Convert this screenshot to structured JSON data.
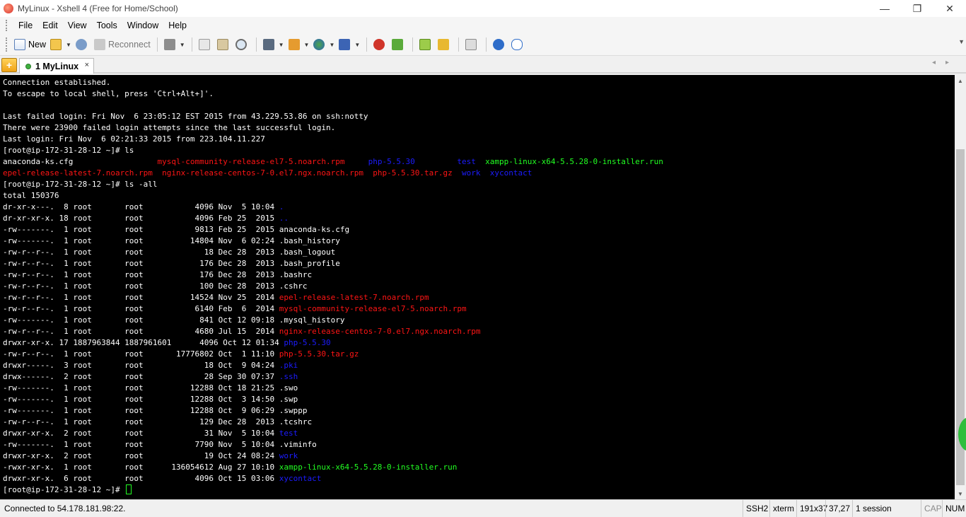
{
  "window": {
    "title": "MyLinux - Xshell 4 (Free for Home/School)",
    "controls": [
      "—",
      "❐",
      "✕"
    ]
  },
  "menu": [
    "File",
    "Edit",
    "View",
    "Tools",
    "Window",
    "Help"
  ],
  "toolbar": {
    "new_label": "New",
    "reconnect_label": "Reconnect"
  },
  "tabs": {
    "add_symbol": "+",
    "active_label": "1 MyLinux",
    "close_symbol": "×",
    "nav_symbols": "◂▸"
  },
  "terminal": {
    "lines": [
      [
        {
          "t": "Connection established."
        }
      ],
      [
        {
          "t": "To escape to local shell, press 'Ctrl+Alt+]'."
        }
      ],
      [
        {
          "t": ""
        }
      ],
      [
        {
          "t": "Last failed login: Fri Nov  6 23:05:12 EST 2015 from 43.229.53.86 on ssh:notty"
        }
      ],
      [
        {
          "t": "There were 23900 failed login attempts since the last successful login."
        }
      ],
      [
        {
          "t": "Last login: Fri Nov  6 02:21:33 2015 from 223.104.11.227"
        }
      ],
      [
        {
          "t": "[root@ip-172-31-28-12 ~]# ls"
        }
      ],
      [
        {
          "t": "anaconda-ks.cfg                  "
        },
        {
          "t": "mysql-community-release-el7-5.noarch.rpm",
          "c": "red"
        },
        {
          "t": "     "
        },
        {
          "t": "php-5.5.30",
          "c": "blue"
        },
        {
          "t": "         "
        },
        {
          "t": "test",
          "c": "blue"
        },
        {
          "t": "  "
        },
        {
          "t": "xampp-linux-x64-5.5.28-0-installer.run",
          "c": "green"
        }
      ],
      [
        {
          "t": "epel-release-latest-7.noarch.rpm",
          "c": "red"
        },
        {
          "t": "  "
        },
        {
          "t": "nginx-release-centos-7-0.el7.ngx.noarch.rpm",
          "c": "red"
        },
        {
          "t": "  "
        },
        {
          "t": "php-5.5.30.tar.gz",
          "c": "red"
        },
        {
          "t": "  "
        },
        {
          "t": "work",
          "c": "blue"
        },
        {
          "t": "  "
        },
        {
          "t": "xycontact",
          "c": "blue"
        }
      ],
      [
        {
          "t": "[root@ip-172-31-28-12 ~]# ls -all"
        }
      ],
      [
        {
          "t": "total 150376"
        }
      ],
      [
        {
          "t": "dr-xr-x---.  8 root       root           4096 Nov  5 10:04 "
        },
        {
          "t": ".",
          "c": "blue"
        }
      ],
      [
        {
          "t": "dr-xr-xr-x. 18 root       root           4096 Feb 25  2015 "
        },
        {
          "t": "..",
          "c": "blue"
        }
      ],
      [
        {
          "t": "-rw-------.  1 root       root           9813 Feb 25  2015 anaconda-ks.cfg"
        }
      ],
      [
        {
          "t": "-rw-------.  1 root       root          14804 Nov  6 02:24 .bash_history"
        }
      ],
      [
        {
          "t": "-rw-r--r--.  1 root       root             18 Dec 28  2013 .bash_logout"
        }
      ],
      [
        {
          "t": "-rw-r--r--.  1 root       root            176 Dec 28  2013 .bash_profile"
        }
      ],
      [
        {
          "t": "-rw-r--r--.  1 root       root            176 Dec 28  2013 .bashrc"
        }
      ],
      [
        {
          "t": "-rw-r--r--.  1 root       root            100 Dec 28  2013 .cshrc"
        }
      ],
      [
        {
          "t": "-rw-r--r--.  1 root       root          14524 Nov 25  2014 "
        },
        {
          "t": "epel-release-latest-7.noarch.rpm",
          "c": "red"
        }
      ],
      [
        {
          "t": "-rw-r--r--.  1 root       root           6140 Feb  6  2014 "
        },
        {
          "t": "mysql-community-release-el7-5.noarch.rpm",
          "c": "red"
        }
      ],
      [
        {
          "t": "-rw-------.  1 root       root            841 Oct 12 09:18 .mysql_history"
        }
      ],
      [
        {
          "t": "-rw-r--r--.  1 root       root           4680 Jul 15  2014 "
        },
        {
          "t": "nginx-release-centos-7-0.el7.ngx.noarch.rpm",
          "c": "red"
        }
      ],
      [
        {
          "t": "drwxr-xr-x. 17 1887963844 1887961601      4096 Oct 12 01:34 "
        },
        {
          "t": "php-5.5.30",
          "c": "blue"
        }
      ],
      [
        {
          "t": "-rw-r--r--.  1 root       root       17776802 Oct  1 11:10 "
        },
        {
          "t": "php-5.5.30.tar.gz",
          "c": "red"
        }
      ],
      [
        {
          "t": "drwxr-----.  3 root       root             18 Oct  9 04:24 "
        },
        {
          "t": ".pki",
          "c": "blue"
        }
      ],
      [
        {
          "t": "drwx------.  2 root       root             28 Sep 30 07:37 "
        },
        {
          "t": ".ssh",
          "c": "blue"
        }
      ],
      [
        {
          "t": "-rw-------.  1 root       root          12288 Oct 18 21:25 .swo"
        }
      ],
      [
        {
          "t": "-rw-------.  1 root       root          12288 Oct  3 14:50 .swp"
        }
      ],
      [
        {
          "t": "-rw-------.  1 root       root          12288 Oct  9 06:29 .swppp"
        }
      ],
      [
        {
          "t": "-rw-r--r--.  1 root       root            129 Dec 28  2013 .tcshrc"
        }
      ],
      [
        {
          "t": "drwxr-xr-x.  2 root       root             31 Nov  5 10:04 "
        },
        {
          "t": "test",
          "c": "blue"
        }
      ],
      [
        {
          "t": "-rw-------.  1 root       root           7790 Nov  5 10:04 .viminfo"
        }
      ],
      [
        {
          "t": "drwxr-xr-x.  2 root       root             19 Oct 24 08:24 "
        },
        {
          "t": "work",
          "c": "blue"
        }
      ],
      [
        {
          "t": "-rwxr-xr-x.  1 root       root      136054612 Aug 27 10:10 "
        },
        {
          "t": "xampp-linux-x64-5.5.28-0-installer.run",
          "c": "green"
        }
      ],
      [
        {
          "t": "drwxr-xr-x.  6 root       root           4096 Oct 15 03:06 "
        },
        {
          "t": "xycontact",
          "c": "blue"
        }
      ],
      [
        {
          "t": "[root@ip-172-31-28-12 ~]# "
        }
      ]
    ]
  },
  "statusbar": {
    "connection": "Connected to 54.178.181.98:22.",
    "protocol": "SSH2",
    "terminal_type": "xterm",
    "size": "191x37",
    "cursor_pos": "37,27",
    "sessions": "1 session",
    "caps": "CAP",
    "num": "NUM"
  },
  "colors": {
    "terminal_bg": "#000000",
    "terminal_fg": "#ffffff",
    "red": "#ff1515",
    "blue": "#1c1cff",
    "green": "#22ff22"
  }
}
